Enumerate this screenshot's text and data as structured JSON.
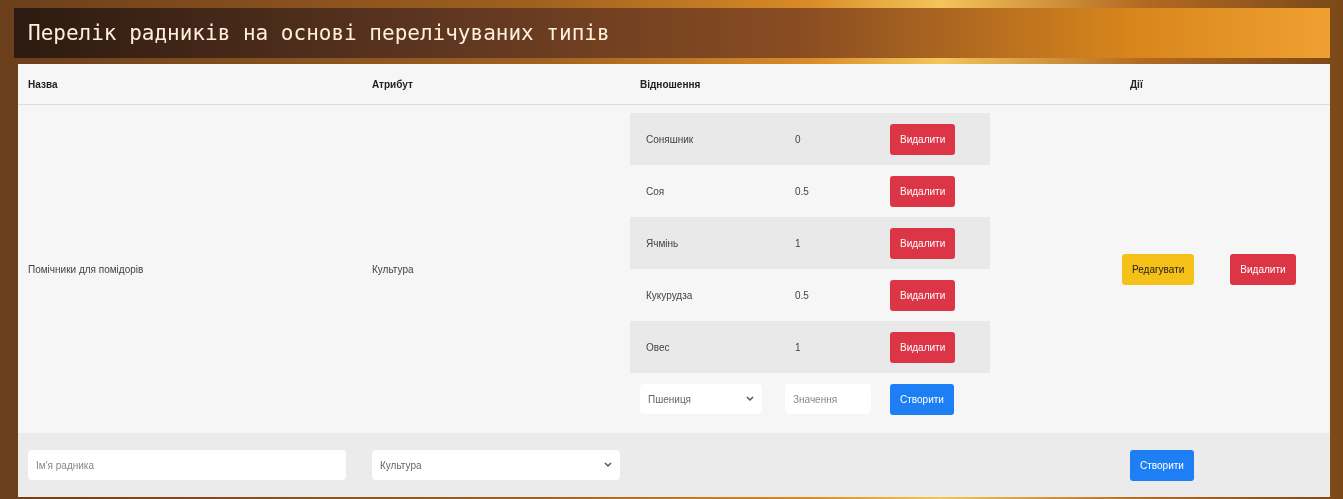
{
  "title": "Перелік радників на основі перелічуваних типів",
  "columns": [
    "Назва",
    "Атрибут",
    "Відношення",
    "Дії"
  ],
  "rows": [
    {
      "name": "Помічники для помідорів",
      "attribute": "Культура",
      "relations": [
        {
          "name": "Соняшник",
          "value": "0",
          "action": "Видалити"
        },
        {
          "name": "Соя",
          "value": "0.5",
          "action": "Видалити"
        },
        {
          "name": "Ячмінь",
          "value": "1",
          "action": "Видалити"
        },
        {
          "name": "Кукурудза",
          "value": "0.5",
          "action": "Видалити"
        },
        {
          "name": "Овес",
          "value": "1",
          "action": "Видалити"
        }
      ],
      "new_relation": {
        "select": "Пшениця",
        "placeholder": "Значення",
        "button": "Створити"
      },
      "actions": [
        {
          "kind": "edit",
          "label": "Редагувати"
        },
        {
          "kind": "delete",
          "label": "Видалити"
        }
      ]
    }
  ],
  "footer": {
    "placeholder": "Ім'я радника",
    "select": "Культура",
    "button": "Створити"
  }
}
